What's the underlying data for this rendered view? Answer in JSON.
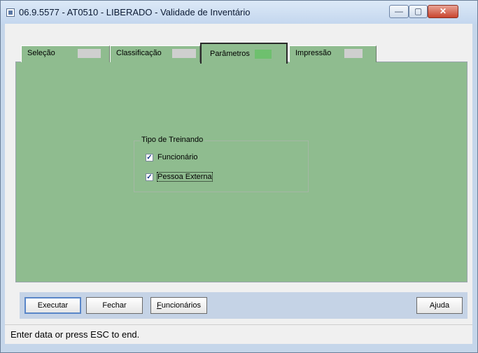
{
  "window": {
    "title": "06.9.5577 - AT0510 - LIBERADO - Validade de Inventário",
    "controls": {
      "minimize": "—",
      "maximize": "▢",
      "close": "✕"
    }
  },
  "tabs": [
    {
      "label": "Seleção",
      "active": false
    },
    {
      "label": "Classificação",
      "active": false
    },
    {
      "label": "Parâmetros",
      "active": true
    },
    {
      "label": "Impressão",
      "active": false
    }
  ],
  "group": {
    "title": "Tipo de Treinando",
    "checkboxes": [
      {
        "label": "Funcionário",
        "checked": true,
        "check": "✓"
      },
      {
        "label": "Pessoa Externa",
        "checked": true,
        "check": "✓"
      }
    ]
  },
  "buttons": {
    "executar": "Executar",
    "fechar": "Fechar",
    "funcionarios_first": "F",
    "funcionarios_rest": "uncionários",
    "ajuda": "Ajuda"
  },
  "status": {
    "text": "Enter data or press ESC to end."
  },
  "colors": {
    "panel": "#8fbc8f",
    "button_bar": "#c5d3e6",
    "active_tab_swatch": "#6ec06e"
  }
}
